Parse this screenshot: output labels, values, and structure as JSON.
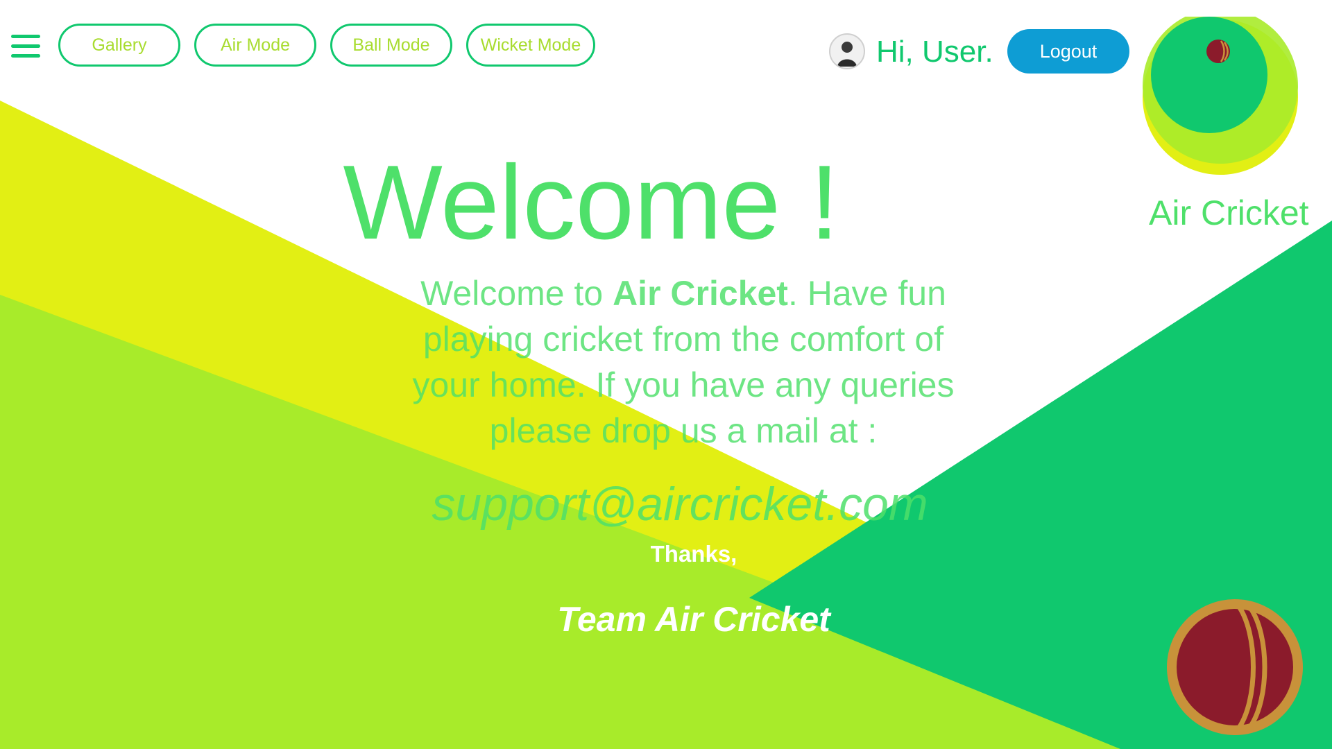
{
  "nav": {
    "items": [
      {
        "label": "Gallery"
      },
      {
        "label": "Air Mode"
      },
      {
        "label": "Ball Mode"
      },
      {
        "label": "Wicket Mode"
      }
    ]
  },
  "user": {
    "greeting": "Hi, User.",
    "logout_label": "Logout"
  },
  "brand": {
    "name": "Air Cricket"
  },
  "hero": {
    "title": "Welcome !",
    "intro_prefix": "Welcome to ",
    "intro_brand": "Air Cricket",
    "intro_suffix": ". Have fun playing cricket from the comfort of your home. If you have any queries please drop us a mail at :",
    "email": "support@aircricket.com",
    "thanks": "Thanks,",
    "signature": "Team Air Cricket"
  },
  "colors": {
    "primary_green": "#10c86e",
    "light_green": "#4ee06a",
    "lime": "#a8eb2a",
    "yellow": "#e2ef14",
    "logout_blue": "#0e9dd4",
    "ball_red": "#8b1b2b",
    "ball_gold": "#c8923a"
  }
}
